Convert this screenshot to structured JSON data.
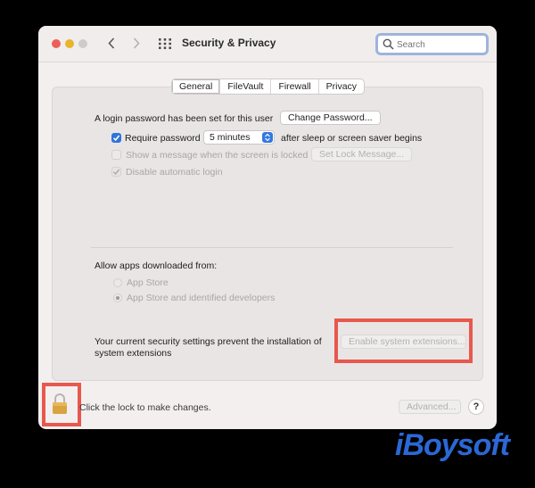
{
  "window": {
    "title": "Security & Privacy"
  },
  "search": {
    "placeholder": "Search"
  },
  "tabs": [
    {
      "label": "General",
      "active": true
    },
    {
      "label": "FileVault",
      "active": false
    },
    {
      "label": "Firewall",
      "active": false
    },
    {
      "label": "Privacy",
      "active": false
    }
  ],
  "general": {
    "login_text": "A login password has been set for this user",
    "change_password_label": "Change Password...",
    "require_password_label": "Require password",
    "require_password_checked": true,
    "require_password_delay": "5 minutes",
    "after_sleep_text": "after sleep or screen saver begins",
    "show_message_label": "Show a message when the screen is locked",
    "show_message_checked": false,
    "set_lock_message_label": "Set Lock Message...",
    "disable_autologin_label": "Disable automatic login",
    "disable_autologin_checked": true
  },
  "allow_apps": {
    "heading": "Allow apps downloaded from:",
    "options": [
      {
        "label": "App Store",
        "selected": false
      },
      {
        "label": "App Store and identified developers",
        "selected": true
      }
    ]
  },
  "extensions": {
    "message_line1": "Your current security settings prevent the installation of",
    "message_line2": "system extensions",
    "button_label": "Enable system extensions..."
  },
  "footer": {
    "lock_text": "Click the lock to make changes.",
    "advanced_label": "Advanced...",
    "help_label": "?"
  },
  "watermark": {
    "text": "iBoysoft"
  },
  "colors": {
    "highlight": "#e8584d",
    "accent": "#2f74d8",
    "brand": "#2b68d6"
  }
}
